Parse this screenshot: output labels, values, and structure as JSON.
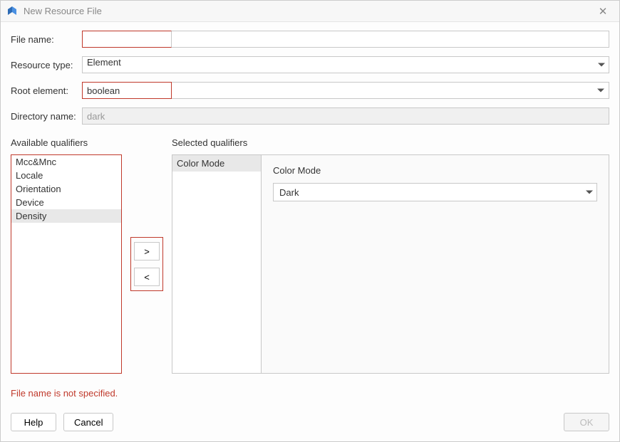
{
  "window": {
    "title": "New Resource File"
  },
  "form": {
    "filename_label": "File name:",
    "filename_value": "",
    "resourcetype_label": "Resource type:",
    "resourcetype_value": "Element",
    "rootelement_label": "Root element:",
    "rootelement_value": "boolean",
    "directory_label": "Directory name:",
    "directory_value": "dark"
  },
  "qualifiers": {
    "available_header": "Available qualifiers",
    "selected_header": "Selected qualifiers",
    "available": [
      {
        "label": "Mcc&Mnc",
        "selected": false
      },
      {
        "label": "Locale",
        "selected": false
      },
      {
        "label": "Orientation",
        "selected": false
      },
      {
        "label": "Device",
        "selected": false
      },
      {
        "label": "Density",
        "selected": true
      }
    ],
    "selected": [
      {
        "label": "Color Mode"
      }
    ],
    "move_right": ">",
    "move_left": "<",
    "detail": {
      "label": "Color Mode",
      "value": "Dark"
    }
  },
  "error": "File name is not specified.",
  "buttons": {
    "help": "Help",
    "cancel": "Cancel",
    "ok": "OK"
  }
}
